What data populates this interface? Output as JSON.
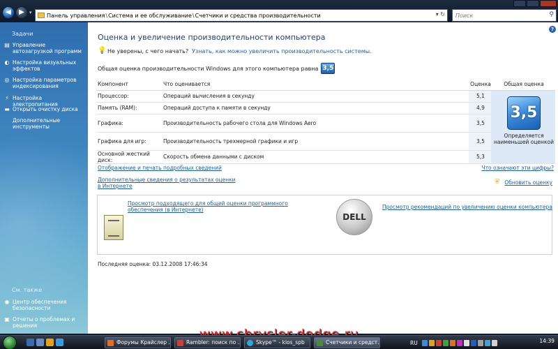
{
  "address_bar": {
    "segments": [
      "Панель управления",
      "Система и ее обслуживание",
      "Счетчики и средства производительности"
    ],
    "separator": "\\",
    "search_placeholder": "Поиск",
    "right_controls": "▾ ↻"
  },
  "left_pane": {
    "tasks_heading": "Задачи",
    "tasks": [
      {
        "label": "Управление автозагрузкой программ",
        "icon": "startup-icon"
      },
      {
        "label": "Настройка визуальных эффектов",
        "icon": "visual-effects-icon"
      },
      {
        "label": "Настройка параметров индексирования",
        "icon": "indexing-icon"
      },
      {
        "label": "Настройка электропитания",
        "icon": "power-icon"
      },
      {
        "label": "Открыть очистку диска",
        "icon": "disk-cleanup-icon"
      },
      {
        "label": "Дополнительные инструменты",
        "icon": "tools-icon"
      }
    ],
    "see_also_heading": "См. также",
    "see_also": [
      {
        "label": "Центр обеспечения безопасности",
        "icon": "security-center-icon"
      },
      {
        "label": "Отчеты о проблемах и решения",
        "icon": "problem-reports-icon"
      }
    ]
  },
  "main": {
    "title": "Оценка и увеличение производительности компьютера",
    "hint_question": "Не уверены, с чего начать?",
    "hint_link": "Узнать, как можно увеличить производительность системы.",
    "overall_label": "Общая оценка производительности Windows для этого компьютера равна",
    "overall_score": "3,5",
    "table": {
      "headers": {
        "component": "Компонент",
        "what": "Что оценивается",
        "score": "Оценка",
        "base": "Общая оценка"
      },
      "rows": [
        {
          "component": "Процессор:",
          "what": "Операций вычисления в секунду",
          "score": "5,1"
        },
        {
          "component": "Память (RAM):",
          "what": "Операций доступа к памяти в секунду",
          "score": "4,9"
        },
        {
          "component": "Графика:",
          "what": "Производительность рабочего стола для Windows Aero",
          "score": "3,5"
        },
        {
          "component": "Графика для игр:",
          "what": "Производительность трехмерной графики и игр",
          "score": "3,5"
        },
        {
          "component": "Основной жесткий диск:",
          "what": "Скорость обмена данными с диском",
          "score": "5,3"
        }
      ],
      "base_score": "3,5",
      "base_text": "Определяется наименьшей оценкой"
    },
    "links": {
      "print_details": "Отображение и печать подробных сведений",
      "what_numbers": "Что означают эти цифры?",
      "more_info": "Дополнительные сведения о результатах оценки в Интернете",
      "refresh": "Обновить оценку"
    },
    "promo": {
      "software_link": "Просмотр подходящего для общей оценки программного обеспечения (в Интернете)",
      "recommend_link": "Просмотр рекомендаций по увеличению оценки компьютера",
      "logo_text": "DELL"
    },
    "last_rating": "Последняя оценка: 03.12.2008 17:46:34"
  },
  "watermark": "www.chrysler-dodge.ru",
  "taskbar": {
    "buttons": [
      {
        "label": "Форумы Крайслер ...",
        "color": "#e07020"
      },
      {
        "label": "Rambler: поиск по ...",
        "color": "#d04030"
      },
      {
        "label": "Skype™ - kios_spb",
        "color": "#2ea8e0"
      },
      {
        "label": "Счетчики и средст...",
        "color": "#4a8a3a"
      }
    ],
    "language": "RU",
    "clock": "14:39"
  }
}
